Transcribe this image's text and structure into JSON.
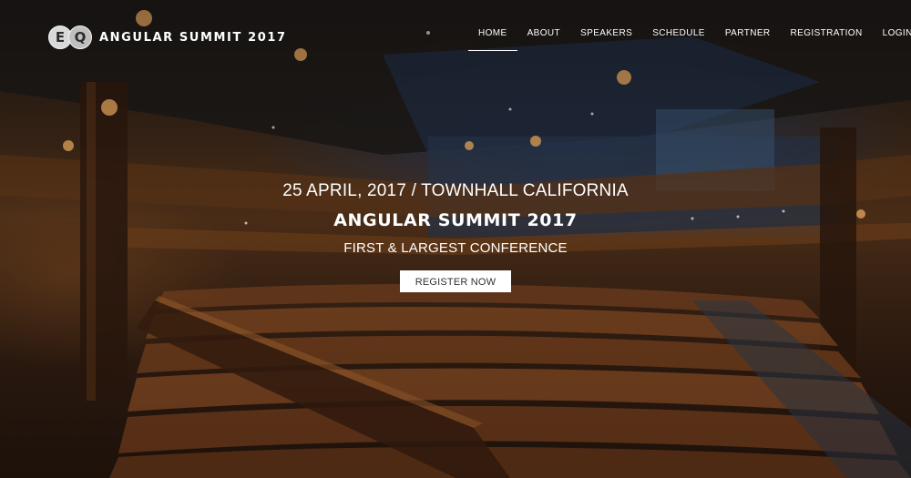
{
  "brand": {
    "logo_letters": [
      "E",
      "Q"
    ],
    "name": "ANGULAR SUMMIT 2017"
  },
  "nav": {
    "items": [
      "HOME",
      "ABOUT",
      "SPEAKERS",
      "SCHEDULE",
      "PARTNER",
      "REGISTRATION",
      "LOGIN"
    ],
    "active": "HOME"
  },
  "hero": {
    "meta": "25 APRIL, 2017 / TOWNHALL CALIFORNIA",
    "title": "ANGULAR SUMMIT 2017",
    "tagline": "FIRST & LARGEST CONFERENCE",
    "cta_label": "REGISTER NOW"
  },
  "colors": {
    "text": "#ffffff",
    "button_bg": "#ffffff",
    "button_text": "#333333"
  }
}
